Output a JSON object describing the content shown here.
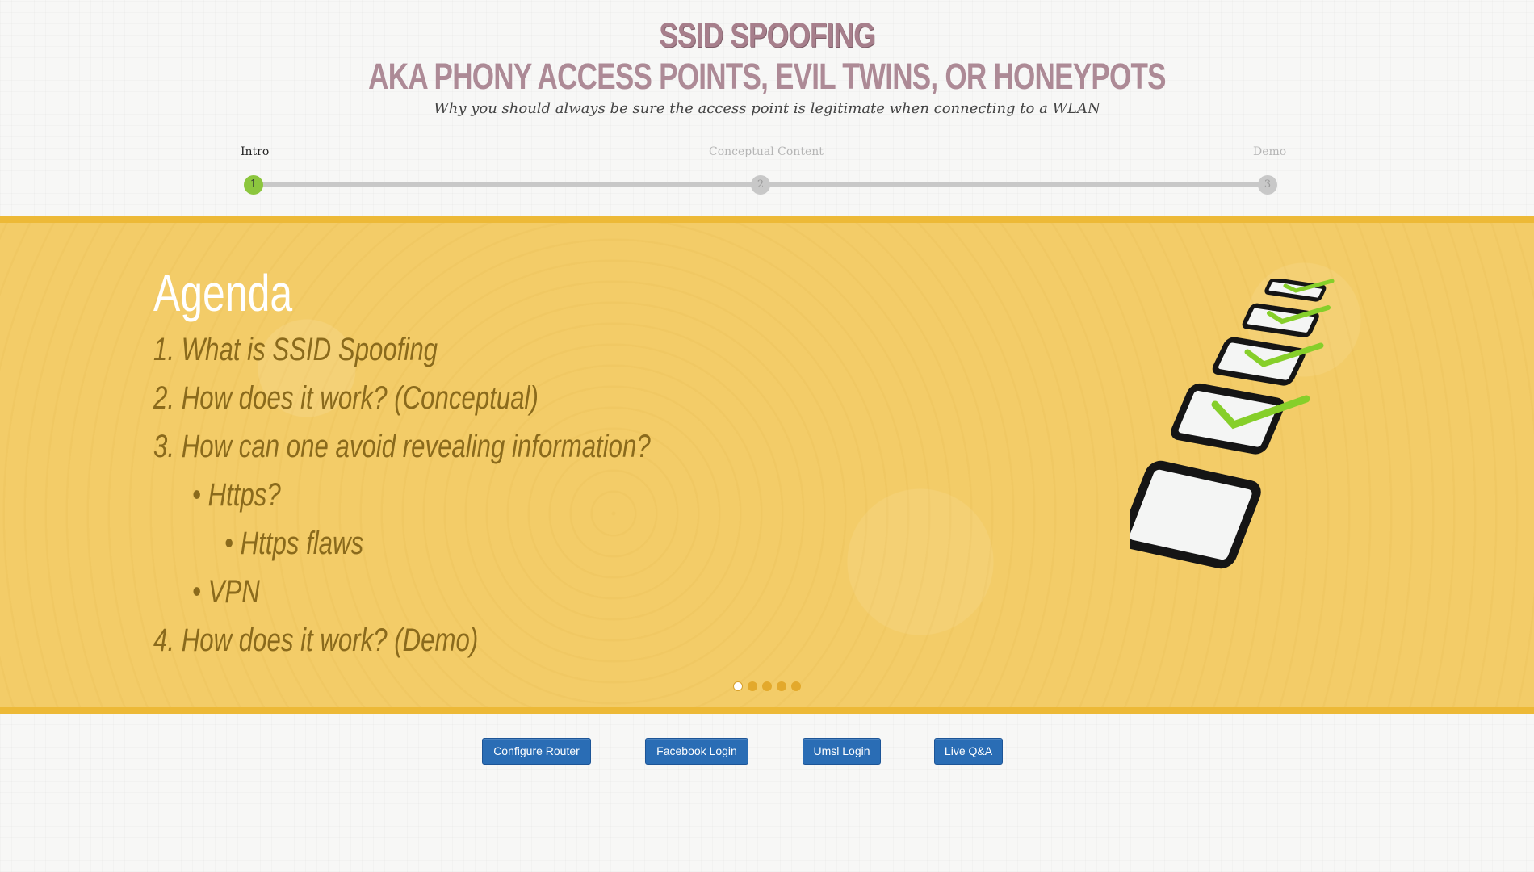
{
  "header": {
    "title": "SSID SPOOFING",
    "subtitle": "AKA PHONY ACCESS POINTS, EVIL TWINS, OR HONEYPOTS",
    "tagline": "Why you should always be sure the access point is legitimate when connecting to a WLAN"
  },
  "stepper": {
    "steps": [
      {
        "label": "Intro",
        "number": "1",
        "active": true
      },
      {
        "label": "Conceptual Content",
        "number": "2",
        "active": false
      },
      {
        "label": "Demo",
        "number": "3",
        "active": false
      }
    ]
  },
  "slide": {
    "title": "Agenda",
    "items": [
      "1. What is SSID Spoofing",
      "2. How does it work? (Conceptual)",
      "3. How can one avoid revealing information?",
      "• Https?",
      "• Https flaws",
      "• VPN",
      "4. How does it work? (Demo)"
    ],
    "carousel": {
      "count": 5,
      "active_index": 0
    },
    "illustration": "checklist-icon"
  },
  "buttons": {
    "configure_router": "Configure Router",
    "facebook_login": "Facebook Login",
    "umsl_login": "Umsl Login",
    "live_qa": "Live Q&A"
  },
  "colors": {
    "band": "#f3cc68",
    "band_border": "#edb937",
    "title": "#a77f8c",
    "agenda_text": "#8a6a1c",
    "active_step": "#8cc63e",
    "button": "#2a6db5"
  }
}
